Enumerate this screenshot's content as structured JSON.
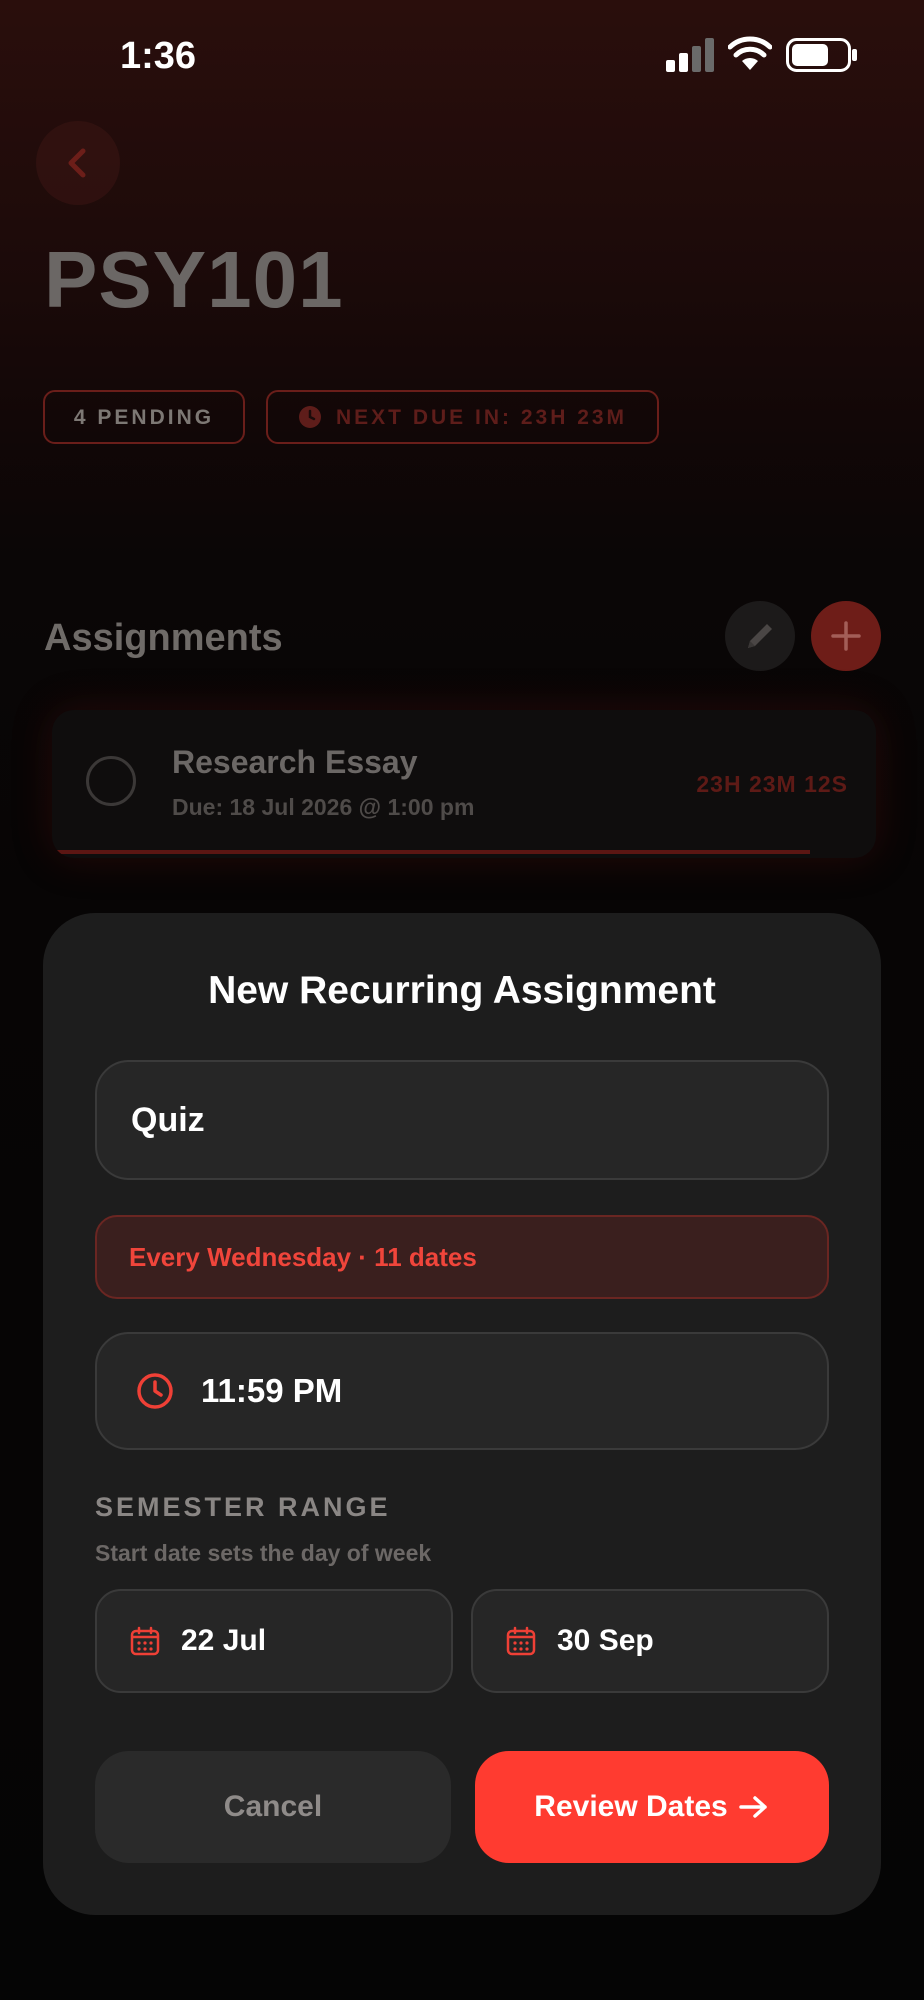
{
  "status_bar": {
    "time": "1:36",
    "icons": [
      "signal-icon",
      "wifi-icon",
      "battery-icon"
    ]
  },
  "header": {
    "back_icon": "chevron-left-icon",
    "course_code": "PSY101",
    "pending_badge": "4 PENDING",
    "next_due_badge": "NEXT DUE IN: 23H 23M",
    "next_due_icon": "clock-icon"
  },
  "assignments": {
    "heading": "Assignments",
    "edit_icon": "pencil-icon",
    "add_icon": "plus-icon",
    "items": [
      {
        "title": "Research Essay",
        "due": "Due: 18 Jul 2026 @ 1:00 pm",
        "countdown": "23H 23M 12S"
      }
    ]
  },
  "modal": {
    "title": "New Recurring Assignment",
    "name_value": "Quiz",
    "recurrence_summary": "Every Wednesday · 11 dates",
    "time_value": "11:59 PM",
    "time_icon": "clock-icon",
    "range_label": "SEMESTER RANGE",
    "range_hint": "Start date sets the day of week",
    "start_date": "22 Jul",
    "end_date": "30 Sep",
    "date_icon": "calendar-icon",
    "cancel_label": "Cancel",
    "review_label": "Review Dates",
    "review_icon": "arrow-right-icon"
  },
  "colors": {
    "accent": "#ff3b30",
    "modal_bg": "#1d1d1d",
    "field_bg": "#262626",
    "chip_bg": "#3a1f1e",
    "background": "#050505"
  }
}
